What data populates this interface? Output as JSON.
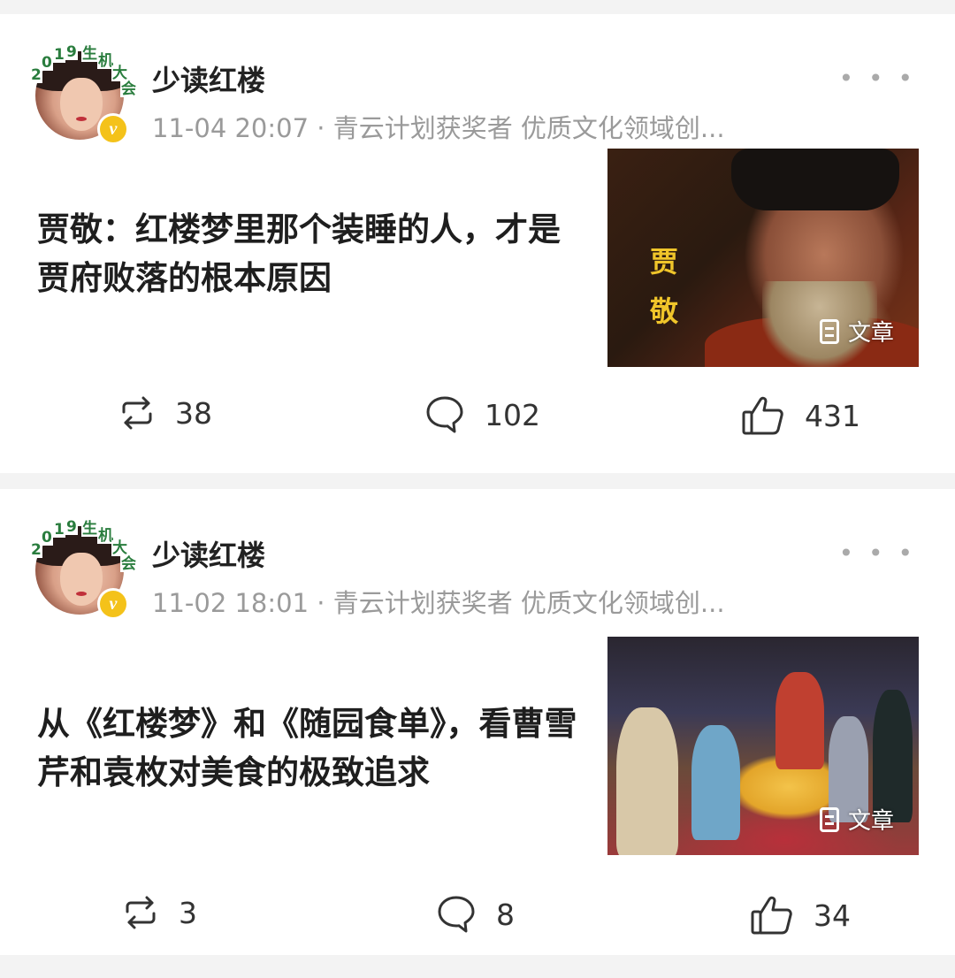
{
  "posts": [
    {
      "author": "少读红楼",
      "meta": "11-04 20:07 · 青云计划获奖者  优质文化领域创...",
      "avatar_badge_text": "2019生机大会",
      "title": "贾敬：红楼梦里那个装睡的人，才是贾府败落的根本原因",
      "thumbnail_caption": "贾敬",
      "thumbnail_tag": "文章",
      "stats": {
        "repost": "38",
        "comment": "102",
        "like": "431"
      }
    },
    {
      "author": "少读红楼",
      "meta": "11-02 18:01 · 青云计划获奖者  优质文化领域创...",
      "avatar_badge_text": "2019生机大会",
      "title": "从《红楼梦》和《随园食单》，看曹雪芹和袁枚对美食的极致追求",
      "thumbnail_tag": "文章",
      "stats": {
        "repost": "3",
        "comment": "8",
        "like": "34"
      }
    }
  ],
  "more_icon": "more-horizontal-icon",
  "verified_icon": "verified-v-icon",
  "colors": {
    "verified": "#f4c21a",
    "meta": "#9a9a9a",
    "text": "#1e1e1e"
  }
}
